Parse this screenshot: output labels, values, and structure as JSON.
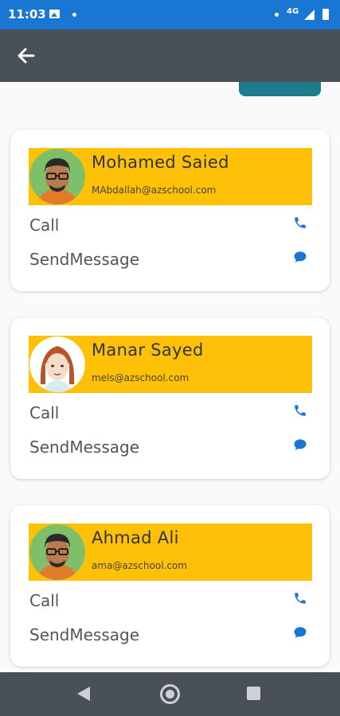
{
  "status_bar": {
    "time": "11:03",
    "network": "4G",
    "icons": [
      "image-icon",
      "notification-dot-icon",
      "dot-icon",
      "signal-icon",
      "battery-icon"
    ]
  },
  "app_bar": {
    "back_icon": "arrow-left-icon"
  },
  "contacts": [
    {
      "name": "Mohamed Saied",
      "email": "MAbdallah@azschool.com",
      "call_label": "Call",
      "message_label": "SendMessage",
      "avatar": "male-avatar-glasses"
    },
    {
      "name": "Manar Sayed",
      "email": "mels@azschool.com",
      "call_label": "Call",
      "message_label": "SendMessage",
      "avatar": "female-avatar-redhair"
    },
    {
      "name": "Ahmad Ali",
      "email": "ama@azschool.com",
      "call_label": "Call",
      "message_label": "SendMessage",
      "avatar": "male-avatar-glasses"
    }
  ],
  "colors": {
    "status_bar": "#1976d2",
    "app_bar": "#4a5058",
    "card_header": "#ffc107",
    "accent_icon": "#1976d2",
    "teal_tab": "#1e7d8c"
  }
}
